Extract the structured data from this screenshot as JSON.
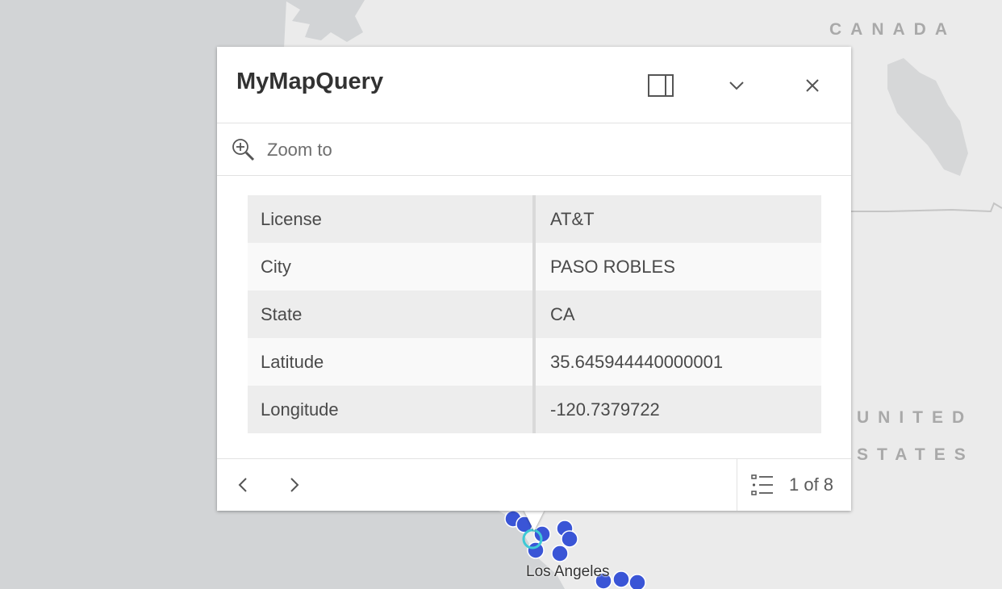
{
  "map": {
    "labels": {
      "canada": "CANADA",
      "united": "UNITED",
      "states": "STATES",
      "los_angeles": "Los Angeles"
    },
    "colors": {
      "water": "#d2d4d6",
      "land": "#ebebeb",
      "marker": "#3a55d6",
      "marker_selected": "#3fc9d6"
    }
  },
  "popup": {
    "title": "MyMapQuery",
    "dock_icon": "dock-icon",
    "collapse_icon": "chevron-down-icon",
    "close_icon": "close-icon",
    "zoom_label": "Zoom to",
    "attributes": [
      {
        "key": "License",
        "value": "AT&T"
      },
      {
        "key": "City",
        "value": "PASO ROBLES"
      },
      {
        "key": "State",
        "value": "CA"
      },
      {
        "key": "Latitude",
        "value": "35.645944440000001"
      },
      {
        "key": "Longitude",
        "value": "-120.7379722"
      }
    ],
    "pagination": "1 of 8"
  }
}
